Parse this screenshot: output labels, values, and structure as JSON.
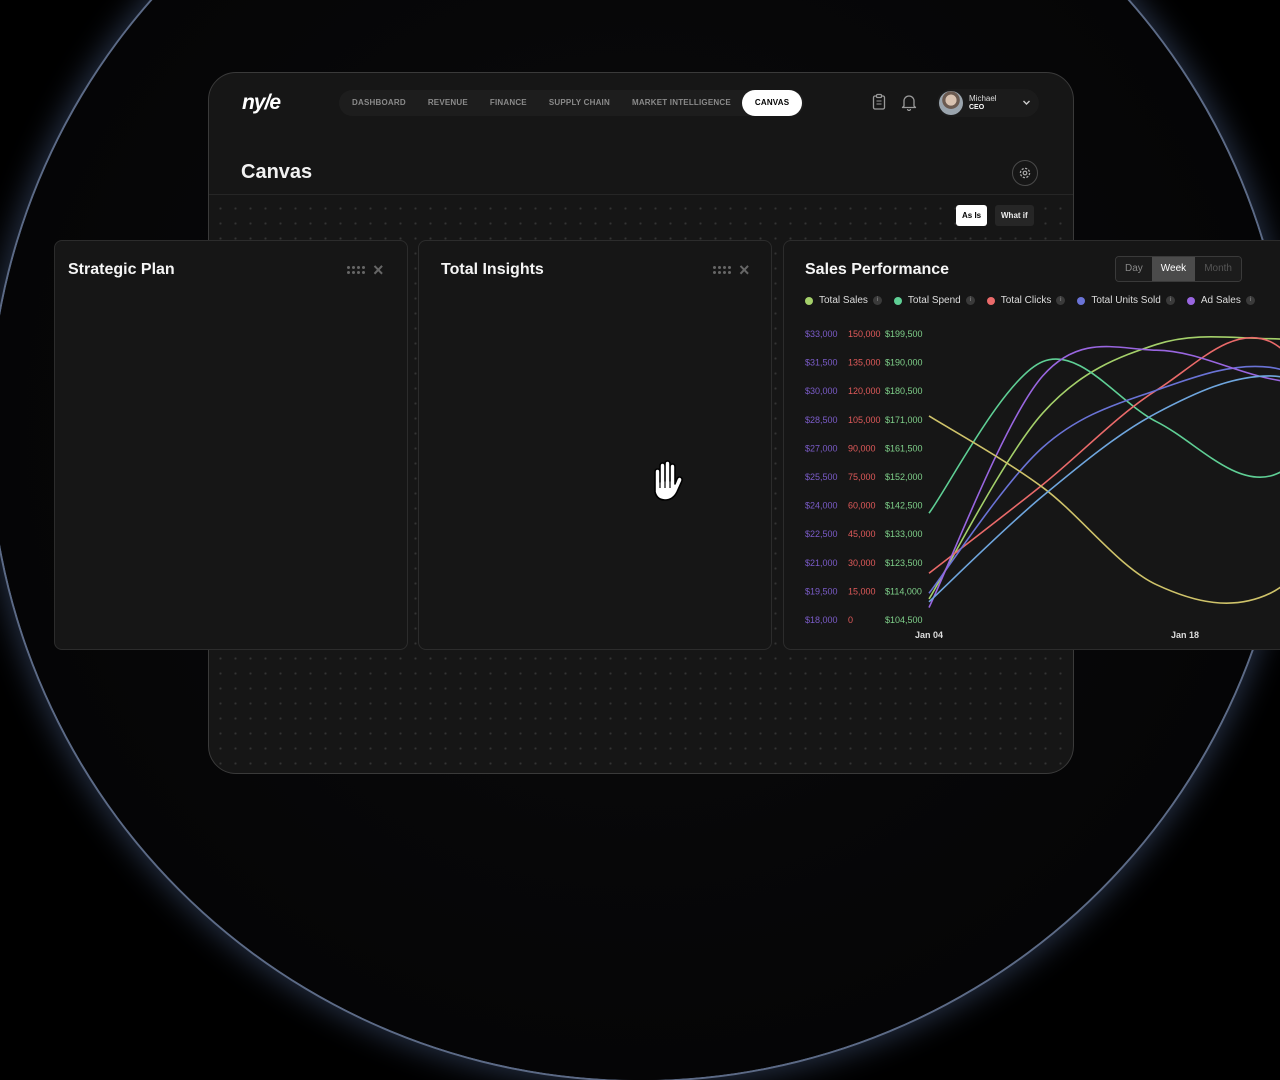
{
  "app": {
    "logo": "ny/e",
    "nav": [
      "DASHBOARD",
      "REVENUE",
      "FINANCE",
      "SUPPLY CHAIN",
      "MARKET INTELLIGENCE",
      "CANVAS"
    ],
    "active_nav": "CANVAS",
    "user": {
      "name": "Michael",
      "role": "CEO"
    },
    "icons": [
      "clipboard-icon",
      "bell-icon",
      "chevron-down-icon",
      "settings-icon"
    ]
  },
  "page": {
    "title": "Canvas",
    "mode_toggle": {
      "as_is": "As Is",
      "what_if": "What if",
      "selected": "As Is"
    }
  },
  "cards": {
    "strategic": {
      "title": "Strategic Plan"
    },
    "insights": {
      "title": "Total Insights"
    },
    "sales": {
      "title": "Sales Performance",
      "ranges": [
        "Day",
        "Week",
        "Month"
      ],
      "selected_range": "Week"
    }
  },
  "chart_data": {
    "type": "line",
    "title": "Sales Performance",
    "legend_placement": "top",
    "grid": false,
    "x_labels": [
      "Jan 04",
      "Jan 18"
    ],
    "y_axes": [
      {
        "color": "#7b5cc9",
        "ticks": [
          "$33,000",
          "$31,500",
          "$30,000",
          "$28,500",
          "$27,000",
          "$25,500",
          "$24,000",
          "$22,500",
          "$21,000",
          "$19,500",
          "$18,000"
        ]
      },
      {
        "color": "#e05a5a",
        "ticks": [
          "150,000",
          "135,000",
          "120,000",
          "105,000",
          "90,000",
          "75,000",
          "60,000",
          "45,000",
          "30,000",
          "15,000",
          "0"
        ]
      },
      {
        "color": "#7fd08a",
        "ticks": [
          "$199,500",
          "$190,000",
          "$180,500",
          "$171,000",
          "$161,500",
          "$152,000",
          "$142,500",
          "$133,000",
          "$123,500",
          "$114,000",
          "$104,500"
        ]
      }
    ],
    "series": [
      {
        "name": "Total Sales",
        "color": "#a4d06a",
        "x": [
          0,
          0.25,
          0.5,
          0.75,
          1
        ],
        "y": [
          0.07,
          0.72,
          0.96,
          0.98,
          0.95
        ]
      },
      {
        "name": "Total Spend",
        "color": "#5fcf95",
        "x": [
          0,
          0.25,
          0.5,
          0.75,
          1
        ],
        "y": [
          0.37,
          0.9,
          0.69,
          0.5,
          0.88
        ]
      },
      {
        "name": "Total Clicks",
        "color": "#ea6a6a",
        "x": [
          0,
          0.25,
          0.5,
          0.75,
          1
        ],
        "y": [
          0.16,
          0.47,
          0.8,
          0.97,
          0.44
        ]
      },
      {
        "name": "Total Units Sold",
        "color": "#6a73d6",
        "x": [
          0,
          0.25,
          0.5,
          0.75,
          1
        ],
        "y": [
          0.09,
          0.6,
          0.8,
          0.88,
          0.7
        ]
      },
      {
        "name": "Ad Sales",
        "color": "#9966e0",
        "x": [
          0,
          0.25,
          0.5,
          0.75,
          1
        ],
        "y": [
          0.04,
          0.85,
          0.94,
          0.84,
          0.78
        ]
      },
      {
        "color": "#cfc36a",
        "x": [
          0,
          0.25,
          0.5,
          0.75,
          1
        ],
        "y": [
          0.71,
          0.46,
          0.12,
          0.09,
          0.5
        ]
      },
      {
        "color": "#6fa6de",
        "x": [
          0,
          0.25,
          0.5,
          0.75,
          1
        ],
        "y": [
          0.06,
          0.43,
          0.72,
          0.85,
          0.71
        ]
      }
    ],
    "info_glyph": "i"
  }
}
